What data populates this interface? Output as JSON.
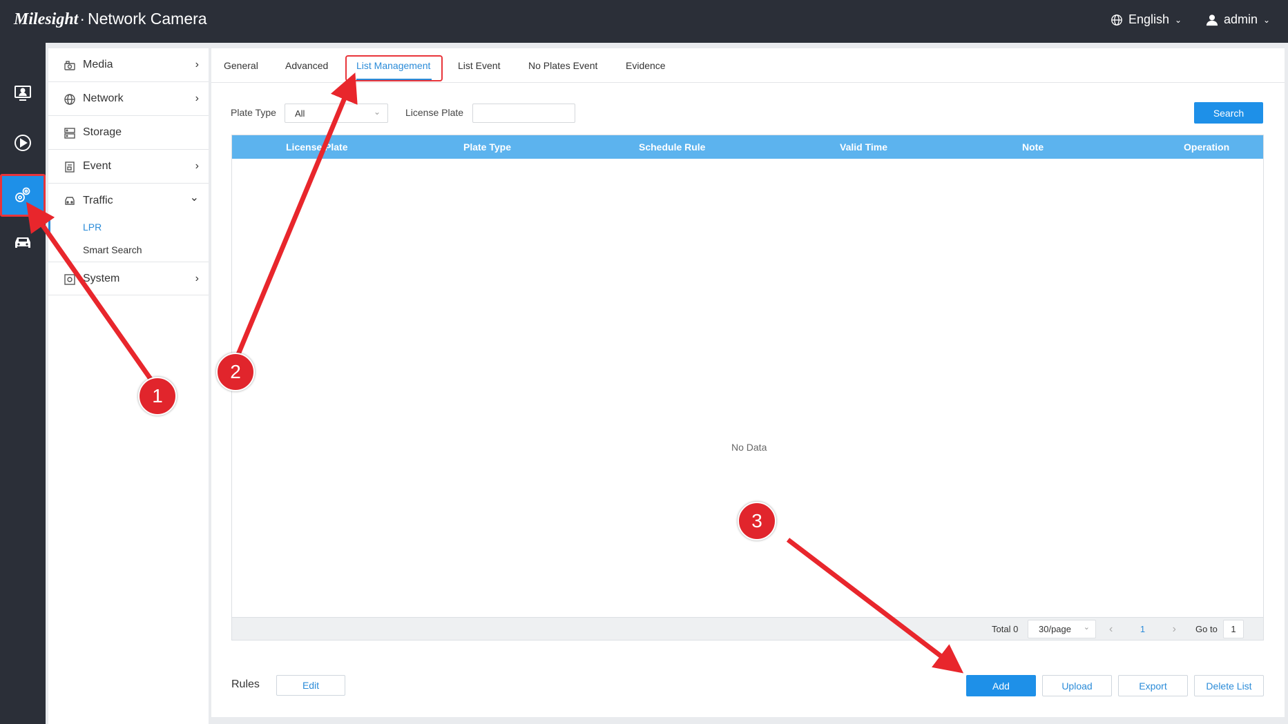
{
  "header": {
    "brand_logo": "Milesight",
    "brand_sep": "·",
    "brand_product": "Network Camera",
    "language": "English",
    "user": "admin"
  },
  "rail": {
    "items": [
      {
        "name": "live-view",
        "icon": "monitor-icon"
      },
      {
        "name": "playback",
        "icon": "play-circle-icon"
      },
      {
        "name": "settings",
        "icon": "gears-icon",
        "active": true
      },
      {
        "name": "vehicle",
        "icon": "car-icon"
      }
    ]
  },
  "sidebar": {
    "items": [
      {
        "label": "Media",
        "icon": "camera-icon",
        "arrow": "›"
      },
      {
        "label": "Network",
        "icon": "globe-icon",
        "arrow": "›"
      },
      {
        "label": "Storage",
        "icon": "storage-icon"
      },
      {
        "label": "Event",
        "icon": "event-icon",
        "arrow": "›"
      },
      {
        "label": "Traffic",
        "icon": "car-icon",
        "arrow": "⌄"
      },
      {
        "label": "System",
        "icon": "system-icon",
        "arrow": "›"
      }
    ],
    "traffic_sub": [
      "LPR",
      "Smart Search"
    ]
  },
  "tabs": [
    "General",
    "Advanced",
    "List Management",
    "List Event",
    "No Plates Event",
    "Evidence"
  ],
  "active_tab": "List Management",
  "filters": {
    "plate_type_label": "Plate Type",
    "plate_type_value": "All",
    "license_plate_label": "License Plate",
    "license_plate_value": "",
    "search_button": "Search"
  },
  "table": {
    "columns": [
      "License Plate",
      "Plate Type",
      "Schedule Rule",
      "Valid Time",
      "Note",
      "Operation"
    ],
    "rows": [],
    "empty_text": "No Data"
  },
  "pagination": {
    "total": "Total 0",
    "page_size": "30/page",
    "current_page": "1",
    "goto_label": "Go to",
    "goto_value": "1",
    "prev": "‹",
    "next": "›"
  },
  "footer": {
    "rules_label": "Rules",
    "edit_button": "Edit",
    "add_button": "Add",
    "upload_button": "Upload",
    "export_button": "Export",
    "delete_button": "Delete List"
  },
  "annotations": {
    "markers": [
      "1",
      "2",
      "3"
    ],
    "color": "#e1252c"
  },
  "colors": {
    "accent": "#1e90e8",
    "table_header": "#5cb3ee",
    "topbar": "#2b2f38",
    "highlight": "#e8343a"
  }
}
